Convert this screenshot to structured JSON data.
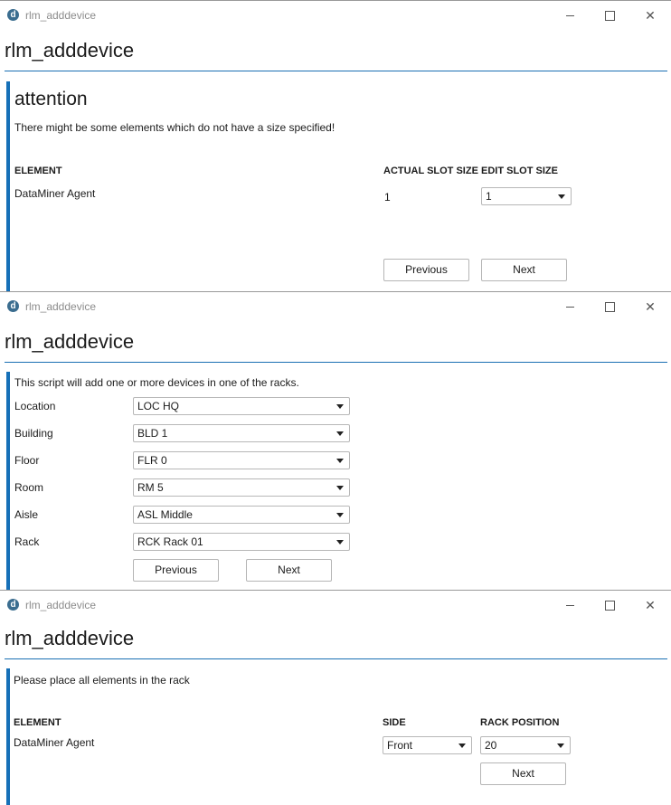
{
  "windows": [
    {
      "title": "rlm_adddevice",
      "heading": "rlm_adddevice",
      "attention": "attention",
      "message": "There might be some elements which do not have a size specified!",
      "columns": {
        "element": "ELEMENT",
        "actual": "ACTUAL SLOT SIZE",
        "edit": "EDIT SLOT SIZE"
      },
      "row": {
        "element": "DataMiner Agent",
        "actual": "1",
        "edit": "1"
      },
      "buttons": {
        "previous": "Previous",
        "next": "Next"
      }
    },
    {
      "title": "rlm_adddevice",
      "heading": "rlm_adddevice",
      "message": "This script will add one or more devices in one of the racks.",
      "fields": [
        {
          "label": "Location",
          "value": "LOC HQ"
        },
        {
          "label": "Building",
          "value": "BLD 1"
        },
        {
          "label": "Floor",
          "value": "FLR 0"
        },
        {
          "label": "Room",
          "value": "RM 5"
        },
        {
          "label": "Aisle",
          "value": "ASL Middle"
        },
        {
          "label": "Rack",
          "value": "RCK Rack 01"
        }
      ],
      "buttons": {
        "previous": "Previous",
        "next": "Next"
      }
    },
    {
      "title": "rlm_adddevice",
      "heading": "rlm_adddevice",
      "message": "Please place all elements in the rack",
      "columns": {
        "element": "ELEMENT",
        "side": "SIDE",
        "position": "RACK POSITION"
      },
      "row": {
        "element": "DataMiner Agent",
        "side": "Front",
        "position": "20"
      },
      "buttons": {
        "next": "Next"
      }
    }
  ],
  "icons": {
    "app": "dataminer-logo-icon",
    "minimize": "minimize-icon",
    "maximize": "maximize-icon",
    "close": "close-icon"
  },
  "colors": {
    "accent": "#1670b8",
    "rule": "#1a6fb3"
  }
}
